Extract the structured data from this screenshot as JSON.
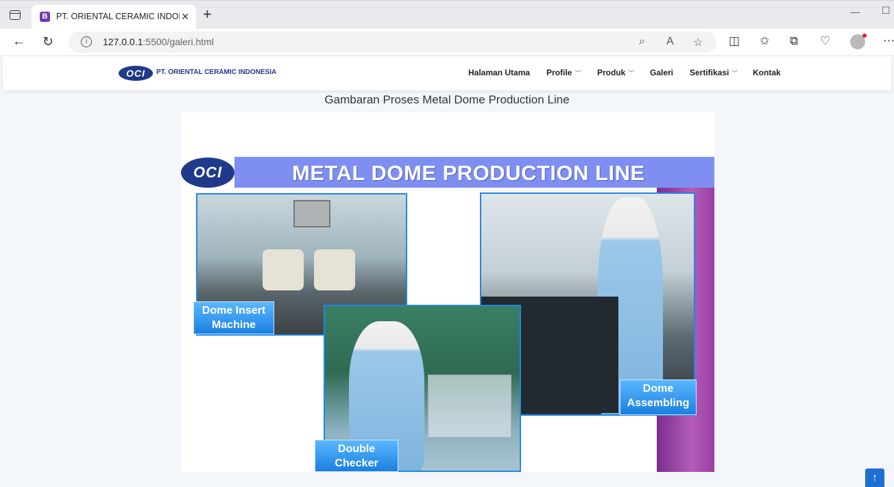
{
  "browser": {
    "tab_title": "PT. ORIENTAL CERAMIC INDONESIA",
    "favicon_letter": "B",
    "url_host": "127.0.0.1",
    "url_path": ":5500/galeri.html",
    "icons": [
      "window-icon",
      "close-icon",
      "new-tab-icon",
      "back-icon",
      "refresh-icon",
      "info-icon",
      "zoom-icon",
      "read-aloud-icon",
      "favorite-icon",
      "split-screen-icon",
      "favorites-list-icon",
      "collections-icon",
      "performance-icon",
      "profile-avatar",
      "more-icon"
    ]
  },
  "header": {
    "logo_mark": "OCI",
    "logo_text": "PT. ORIENTAL CERAMIC INDONESIA",
    "nav": [
      {
        "label": "Halaman Utama"
      },
      {
        "label": "Profile",
        "dropdown": true
      },
      {
        "label": "Produk",
        "dropdown": true
      },
      {
        "label": "Galeri"
      },
      {
        "label": "Sertifikasi",
        "dropdown": true
      },
      {
        "label": "Kontak"
      }
    ]
  },
  "main": {
    "heading": "Gambaran Proses Metal Dome Production Line",
    "image": {
      "banner_text": "METAL DOME PRODUCTION LINE",
      "logo_mark": "OCI",
      "captions": {
        "c1_line1": "Dome Insert",
        "c1_line2": "Machine",
        "c2_line1": "Dome",
        "c2_line2": "Assembling",
        "c3_line1": "Double",
        "c3_line2": "Checker"
      }
    }
  },
  "colors": {
    "brand": "#1f3a8a",
    "banner": "#7f8ff1",
    "caption": "#1b7fe0",
    "to_top": "#1f6fd1"
  }
}
